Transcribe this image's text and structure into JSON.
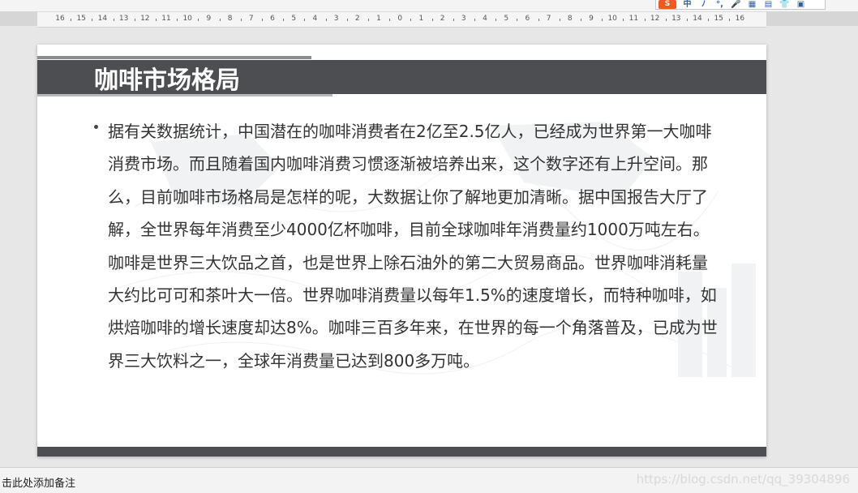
{
  "ime_toolbar": {
    "logo": "S",
    "lang": "中",
    "glyphs": [
      "ﾉ",
      "°,",
      "🎤",
      "▦",
      "▤",
      "👕",
      "▣"
    ]
  },
  "ruler": {
    "labels": [
      "16",
      "15",
      "14",
      "13",
      "12",
      "11",
      "10",
      "9",
      "8",
      "7",
      "6",
      "5",
      "4",
      "3",
      "2",
      "1",
      "0",
      "1",
      "2",
      "3",
      "4",
      "5",
      "6",
      "7",
      "8",
      "9",
      "10",
      "11",
      "12",
      "13",
      "14",
      "15",
      "16"
    ]
  },
  "slide": {
    "title": "咖啡市场格局",
    "body": "据有关数据统计，中国潜在的咖啡消费者在2亿至2.5亿人，已经成为世界第一大咖啡消费市场。而且随着国内咖啡消费习惯逐渐被培养出来，这个数字还有上升空间。那么，目前咖啡市场格局是怎样的呢，大数据让你了解地更加清晰。据中国报告大厅了解，全世界每年消费至少4000亿杯咖啡，目前全球咖啡年消费量约1000万吨左右。咖啡是世界三大饮品之首，也是世界上除石油外的第二大贸易商品。世界咖啡消耗量大约比可可和茶叶大一倍。世界咖啡消费量以每年1.5%的速度增长，而特种咖啡，如烘焙咖啡的增长速度却达8%。咖啡三百多年来，在世界的每一个角落普及，已成为世界三大饮料之一，全球年消费量已达到800多万吨。"
  },
  "notes": {
    "placeholder": "击此处添加备注"
  },
  "watermark": "https://blog.csdn.net/qq_39304896",
  "colors": {
    "title_bar": "#4d4e52",
    "accent": "#8c8d90",
    "text": "#333333"
  }
}
